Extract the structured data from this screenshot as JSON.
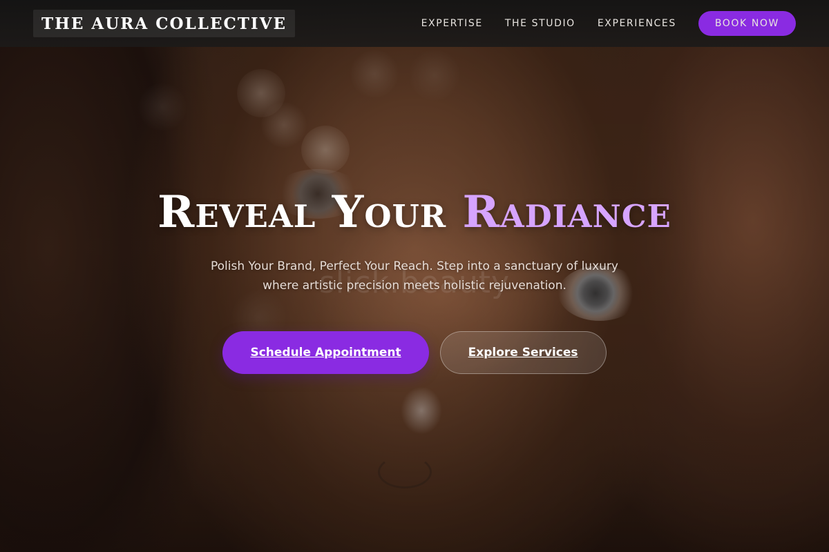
{
  "brand": {
    "logo_text": "THE AURA COLLECTIVE"
  },
  "nav": {
    "items": [
      {
        "label": "EXPERTISE"
      },
      {
        "label": "THE STUDIO"
      },
      {
        "label": "EXPERIENCES"
      }
    ],
    "book_now_label": "BOOK NOW"
  },
  "hero": {
    "headline_main": "Reveal Your ",
    "headline_accent": "Radiance",
    "subtitle": "Polish Your Brand, Perfect Your Reach. Step into a sanctuary of luxury where artistic precision meets holistic rejuvenation.",
    "watermark": "slick.beauty",
    "primary_cta": "Schedule Appointment",
    "secondary_cta": "Explore Services"
  },
  "colors": {
    "accent": "#8a2be2",
    "headline_accent": "#d6a4ff",
    "header_bg": "#1a1a1a"
  }
}
